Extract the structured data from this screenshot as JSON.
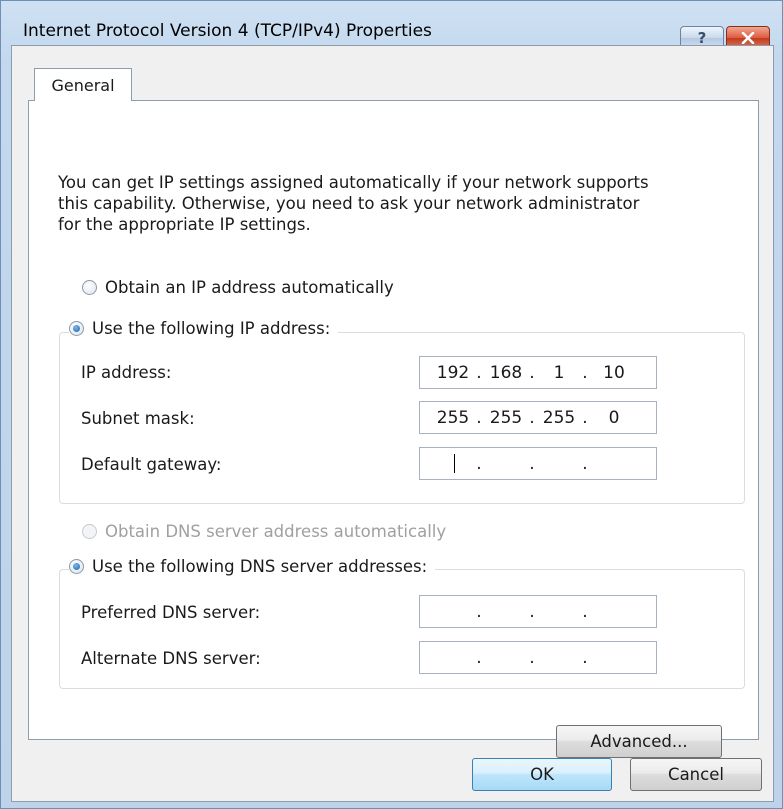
{
  "window": {
    "title": "Internet Protocol Version 4 (TCP/IPv4) Properties",
    "help_label": "?",
    "close_icon": "close-icon"
  },
  "tabs": [
    {
      "label": "General",
      "selected": true
    }
  ],
  "intro": {
    "lines": [
      "You can get IP settings assigned automatically if your network supports",
      "this capability. Otherwise, you need to ask your network administrator",
      "for the appropriate IP settings."
    ]
  },
  "ip_mode": {
    "auto_label": "Obtain an IP address automatically",
    "manual_label": "Use the following IP address:",
    "selected": "manual"
  },
  "ip_fields": {
    "ip_address": {
      "label": "IP address:",
      "octets": [
        "192",
        "168",
        "1",
        "10"
      ]
    },
    "subnet_mask": {
      "label": "Subnet mask:",
      "octets": [
        "255",
        "255",
        "255",
        "0"
      ]
    },
    "default_gateway": {
      "label": "Default gateway:",
      "octets": [
        "",
        "",
        "",
        ""
      ]
    }
  },
  "dns_mode": {
    "auto_label": "Obtain DNS server address automatically",
    "auto_disabled": true,
    "manual_label": "Use the following DNS server addresses:",
    "selected": "manual"
  },
  "dns_fields": {
    "preferred": {
      "label": "Preferred DNS server:",
      "octets": [
        "",
        "",
        "",
        ""
      ]
    },
    "alternate": {
      "label": "Alternate DNS server:",
      "octets": [
        "",
        "",
        "",
        ""
      ]
    }
  },
  "buttons": {
    "advanced": "Advanced...",
    "ok": "OK",
    "cancel": "Cancel"
  },
  "colors": {
    "title_gradient_top": "#cfe1f3",
    "close_red": "#c23a1e",
    "default_button_blue": "#3c7fb1"
  }
}
